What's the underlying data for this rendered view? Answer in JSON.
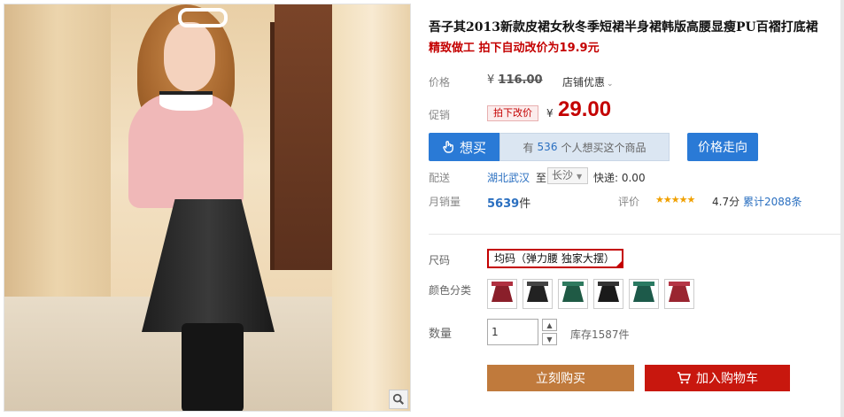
{
  "product": {
    "title": "吾子其2013新款皮裙女秋冬季短裙半身裙韩版高腰显瘦PU百褶打底裙",
    "subtitle": "精致做工 拍下自动改价为19.9元"
  },
  "price": {
    "label": "价格",
    "currency": "¥",
    "original": "116.00",
    "shop_discount": "店铺优惠"
  },
  "promo": {
    "label": "促销",
    "tag": "拍下改价",
    "currency": "¥",
    "price": "29.00"
  },
  "want": {
    "button": "想买",
    "prefix": "有",
    "count": "536",
    "suffix": "个人想买这个商品"
  },
  "trend_button": "价格走向",
  "shipping": {
    "label": "配送",
    "from": "湖北武汉",
    "to_label": "至",
    "city": "长沙",
    "fee": "快递: 0.00"
  },
  "sales": {
    "label": "月销量",
    "count": "5639",
    "unit": "件"
  },
  "rating": {
    "label": "评价",
    "stars": "★★★★★",
    "score": "4.7分",
    "reviews": "累计2088条"
  },
  "size": {
    "label": "尺码",
    "option": "均码（弹力腰 独家大摆）"
  },
  "color": {
    "label": "颜色分类",
    "swatches": [
      {
        "skirt": "#8a1f2a",
        "band": "#b03040"
      },
      {
        "skirt": "#222222",
        "band": "#444444"
      },
      {
        "skirt": "#1f5a45",
        "band": "#2f7a5f"
      },
      {
        "skirt": "#1a1a1a",
        "band": "#333333"
      },
      {
        "skirt": "#1d5a4a",
        "band": "#2a7a62"
      },
      {
        "skirt": "#9a2530",
        "band": "#b53545"
      }
    ]
  },
  "quantity": {
    "label": "数量",
    "value": "1",
    "stock": "库存1587件"
  },
  "buttons": {
    "buy": "立刻购买",
    "cart": "加入购物车"
  }
}
